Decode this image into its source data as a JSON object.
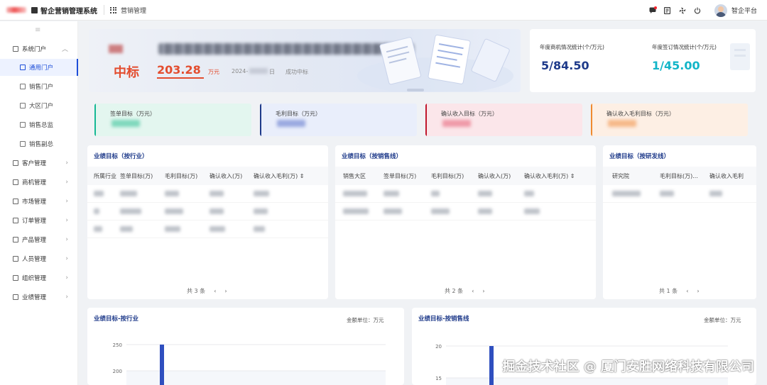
{
  "header": {
    "app_title": "智企营销管理系统",
    "module_label": "营销管理",
    "user_name": "智企平台"
  },
  "sidebar": {
    "groups": [
      {
        "label": "系统门户",
        "expanded": true,
        "children": [
          "通用门户",
          "销售门户",
          "大区门户",
          "销售总监",
          "销售副总"
        ],
        "active_child": 0
      },
      {
        "label": "客户管理"
      },
      {
        "label": "商机管理"
      },
      {
        "label": "市场管理"
      },
      {
        "label": "订单管理"
      },
      {
        "label": "产品管理"
      },
      {
        "label": "人员管理"
      },
      {
        "label": "组织管理"
      },
      {
        "label": "业绩管理"
      }
    ]
  },
  "banner": {
    "win_label": "中标",
    "amount": "203.28",
    "amount_unit": "万元",
    "date_prefix": "2024-",
    "date_suffix": "日",
    "status": "成功中标"
  },
  "stats": [
    {
      "title": "年度商机情况统计(个/万元)",
      "value": "5/84.50",
      "color": "#1e3a8a"
    },
    {
      "title": "年度签订情况统计(个/万元)",
      "value": "1/45.00",
      "color": "#13b5c8"
    }
  ],
  "targets": [
    {
      "label": "签单目标（万元）",
      "bar": "#16b894",
      "bg": "#e3f6ef",
      "blur": "#7fd8bc"
    },
    {
      "label": "毛利目标（万元）",
      "bar": "#1e3a8a",
      "bg": "#e9eefb",
      "blur": "#9aa9e0"
    },
    {
      "label": "确认收入目标（万元）",
      "bar": "#c0182e",
      "bg": "#fbe6ea",
      "blur": "#ef9aa8"
    },
    {
      "label": "确认收入毛利目标（万元）",
      "bar": "#f08a2e",
      "bg": "#fdefe4",
      "blur": "#f6b98a"
    }
  ],
  "tables": [
    {
      "title": "业绩目标（按行业）",
      "columns": [
        "所属行业",
        "签单目标(万)",
        "毛利目标(万)",
        "确认收入(万)",
        "确认收入毛利(万) ⇕"
      ],
      "rows": 3,
      "pager_text": "共 3 条"
    },
    {
      "title": "业绩目标（按销售线）",
      "columns": [
        "销售大区",
        "签单目标(万)",
        "毛利目标(万)",
        "确认收入(万)",
        "确认收入毛利(万) ⇕"
      ],
      "rows": 2,
      "pager_text": "共 2 条"
    },
    {
      "title": "业绩目标（按研发线）",
      "columns": [
        "研究院",
        "毛利目标(万)...",
        "确认收入毛利"
      ],
      "rows": 1,
      "pager_text": "共 1 条"
    }
  ],
  "charts": [
    {
      "title": "业绩目标-按行业",
      "unit": "金额单位：万元"
    },
    {
      "title": "业绩目标-按销售线",
      "unit": "金额单位：万元"
    }
  ],
  "chart_data": [
    {
      "type": "bar",
      "title": "业绩目标-按行业",
      "xlabel": "",
      "ylabel": "",
      "y_ticks": [
        250,
        200
      ],
      "ylim": [
        0,
        250
      ],
      "visible_bar_value_min": 250,
      "grid": true
    },
    {
      "type": "bar",
      "title": "业绩目标-按销售线",
      "xlabel": "",
      "ylabel": "",
      "y_ticks": [
        20,
        15
      ],
      "ylim": [
        0,
        20
      ],
      "visible_bar_value_min": 20,
      "grid": true
    }
  ],
  "watermark": "掘金技术社区 @ 厦门安胜网络科技有限公司"
}
